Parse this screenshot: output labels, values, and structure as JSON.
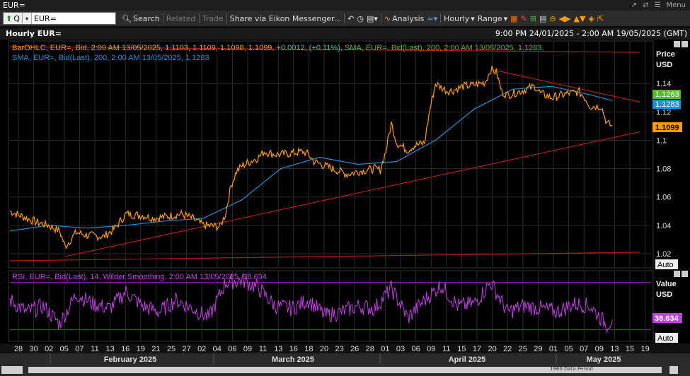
{
  "window": {
    "title": "EUR=",
    "menu_label": "Menu"
  },
  "toolbar": {
    "ric_input": "EUR=",
    "q_label": "Q",
    "search_label": "Search",
    "related_label": "Related",
    "trade_label": "Trade",
    "share_label": "Share via Eikon Messenger...",
    "analysis_label": "Analysis",
    "interval_label": "Hourly",
    "range_label": "Range"
  },
  "header": {
    "title": "Hourly EUR=",
    "date_range": "9:00 PM 24/01/2025 - 2:00 AM 19/05/2025 (GMT)"
  },
  "legend": {
    "ohlc_text": "BarOHLC, EUR=, Bid, 2:00 AM 13/05/2025, 1.1103, 1.1109, 1.1098, 1.1099,",
    "ohlc_change": "+0.0012, (+0.11%),",
    "sma_line1": "SMA, EUR=, Bid(Last), 200, 2:00 AM 13/05/2025, 1.1283,",
    "sma_line2": "SMA, EUR=, Bid(Last), 200, 2:00 AM 13/05/2025, 1.1283",
    "rsi_text": "RSI, EUR=, Bid(Last), 14, Wilder Smoothing, 2:00 AM 13/05/2025, 38.634"
  },
  "price_axis": {
    "title": "Price",
    "unit": "USD",
    "auto_label": "Auto",
    "last_price_tag": "1.1099",
    "sma_tag_green": "1.1283",
    "sma_tag_blue": "1.1283"
  },
  "rsi_axis": {
    "title": "Value",
    "unit": "USD",
    "auto_label": "Auto",
    "last_value_tag": "38.634"
  },
  "colors": {
    "price": "#ff9c00",
    "sma": "#1f8fd6",
    "trendline": "#b41a1a",
    "rsi": "#c040e0",
    "rsi_band": "#9020b0",
    "grid": "#2a2a2a",
    "green_tag": "#5ab82e",
    "blue_tag": "#1f8fd6"
  },
  "footer": {
    "scroll_label": "1960 Data Period"
  },
  "chart_data": {
    "type": "line",
    "price_panel": {
      "ylim": [
        1.01,
        1.17
      ],
      "yticks": [
        1.02,
        1.04,
        1.06,
        1.08,
        1.1,
        1.12,
        1.14
      ],
      "ytick_labels": [
        "1.02",
        "1.04",
        "1.06",
        "1.08",
        "1.1",
        "1.12",
        "1.14"
      ],
      "series": [
        {
          "name": "BarOHLC, EUR=, Bid",
          "dates": [
            "2025-01-24",
            "2025-01-27",
            "2025-01-29",
            "2025-01-31",
            "2025-02-02",
            "2025-02-03",
            "2025-02-05",
            "2025-02-07",
            "2025-02-10",
            "2025-02-12",
            "2025-02-14",
            "2025-02-17",
            "2025-02-19",
            "2025-02-21",
            "2025-02-24",
            "2025-02-26",
            "2025-02-28",
            "2025-03-03",
            "2025-03-04",
            "2025-03-05",
            "2025-03-06",
            "2025-03-07",
            "2025-03-10",
            "2025-03-11",
            "2025-03-13",
            "2025-03-14",
            "2025-03-18",
            "2025-03-19",
            "2025-03-20",
            "2025-03-24",
            "2025-03-26",
            "2025-03-28",
            "2025-03-31",
            "2025-04-01",
            "2025-04-02",
            "2025-04-03",
            "2025-04-04",
            "2025-04-06",
            "2025-04-07",
            "2025-04-09",
            "2025-04-10",
            "2025-04-11",
            "2025-04-13",
            "2025-04-14",
            "2025-04-16",
            "2025-04-18",
            "2025-04-20",
            "2025-04-21",
            "2025-04-22",
            "2025-04-23",
            "2025-04-24",
            "2025-04-25",
            "2025-04-29",
            "2025-04-30",
            "2025-05-02",
            "2025-05-05",
            "2025-05-07",
            "2025-05-08",
            "2025-05-09",
            "2025-05-11",
            "2025-05-12",
            "2025-05-13"
          ],
          "values": [
            1.05,
            1.045,
            1.042,
            1.04,
            1.036,
            1.025,
            1.035,
            1.033,
            1.032,
            1.038,
            1.048,
            1.047,
            1.045,
            1.046,
            1.048,
            1.045,
            1.04,
            1.039,
            1.048,
            1.068,
            1.078,
            1.082,
            1.088,
            1.092,
            1.09,
            1.09,
            1.092,
            1.09,
            1.085,
            1.079,
            1.076,
            1.078,
            1.08,
            1.079,
            1.092,
            1.112,
            1.098,
            1.093,
            1.096,
            1.098,
            1.122,
            1.14,
            1.135,
            1.135,
            1.138,
            1.139,
            1.141,
            1.15,
            1.148,
            1.134,
            1.132,
            1.133,
            1.138,
            1.133,
            1.13,
            1.133,
            1.134,
            1.13,
            1.124,
            1.124,
            1.112,
            1.11
          ]
        },
        {
          "name": "SMA, EUR=, Bid(Last), 200",
          "dates": [
            "2025-01-24",
            "2025-01-31",
            "2025-02-07",
            "2025-02-14",
            "2025-02-21",
            "2025-02-28",
            "2025-03-07",
            "2025-03-14",
            "2025-03-21",
            "2025-03-28",
            "2025-04-04",
            "2025-04-11",
            "2025-04-18",
            "2025-04-25",
            "2025-05-02",
            "2025-05-09",
            "2025-05-13"
          ],
          "values": [
            1.036,
            1.04,
            1.038,
            1.04,
            1.043,
            1.045,
            1.058,
            1.08,
            1.088,
            1.083,
            1.085,
            1.1,
            1.122,
            1.136,
            1.138,
            1.132,
            1.128
          ]
        }
      ]
    },
    "trendlines": [
      {
        "name": "upper-trendline",
        "dates": [
          "2025-01-24",
          "2025-05-18"
        ],
        "values": [
          1.166,
          1.162
        ]
      },
      {
        "name": "falling-trendline",
        "dates": [
          "2025-04-21",
          "2025-05-18"
        ],
        "values": [
          1.15,
          1.127
        ]
      },
      {
        "name": "support-trendline",
        "dates": [
          "2025-02-03",
          "2025-05-18"
        ],
        "values": [
          1.018,
          1.106
        ]
      },
      {
        "name": "lower-trendline",
        "dates": [
          "2025-01-24",
          "2025-05-18"
        ],
        "values": [
          1.015,
          1.021
        ]
      }
    ],
    "rsi_panel": {
      "name": "RSI, EUR=, Bid(Last), 14, Wilder Smoothing",
      "band_values": [
        70,
        30
      ],
      "ylim": [
        20,
        80
      ],
      "last_value": 38.634,
      "dates": [
        "2025-01-24",
        "2025-01-27",
        "2025-01-30",
        "2025-02-02",
        "2025-02-05",
        "2025-02-08",
        "2025-02-11",
        "2025-02-14",
        "2025-02-17",
        "2025-02-20",
        "2025-02-23",
        "2025-02-26",
        "2025-03-01",
        "2025-03-04",
        "2025-03-07",
        "2025-03-10",
        "2025-03-13",
        "2025-03-16",
        "2025-03-19",
        "2025-03-22",
        "2025-03-25",
        "2025-03-28",
        "2025-03-31",
        "2025-04-03",
        "2025-04-06",
        "2025-04-09",
        "2025-04-12",
        "2025-04-15",
        "2025-04-18",
        "2025-04-21",
        "2025-04-24",
        "2025-04-27",
        "2025-04-30",
        "2025-05-03",
        "2025-05-06",
        "2025-05-09",
        "2025-05-12",
        "2025-05-13"
      ],
      "values": [
        55,
        45,
        50,
        35,
        60,
        52,
        48,
        62,
        50,
        45,
        55,
        48,
        40,
        70,
        72,
        65,
        50,
        48,
        55,
        42,
        45,
        50,
        48,
        65,
        40,
        55,
        68,
        50,
        52,
        70,
        45,
        50,
        48,
        45,
        52,
        50,
        34,
        38.6
      ]
    },
    "x_tick_labels": [
      "28",
      "30",
      "02",
      "05",
      "07",
      "11",
      "13",
      "16",
      "19",
      "21",
      "25",
      "27",
      "02",
      "04",
      "06",
      "09",
      "11",
      "13",
      "16",
      "18",
      "20",
      "23",
      "26",
      "28",
      "01",
      "03",
      "06",
      "09",
      "11",
      "15",
      "17",
      "20",
      "22",
      "25",
      "29",
      "01",
      "05",
      "07",
      "09",
      "13",
      "15",
      "19"
    ],
    "month_labels": [
      "February 2025",
      "March 2025",
      "April 2025",
      "May 2025"
    ]
  }
}
